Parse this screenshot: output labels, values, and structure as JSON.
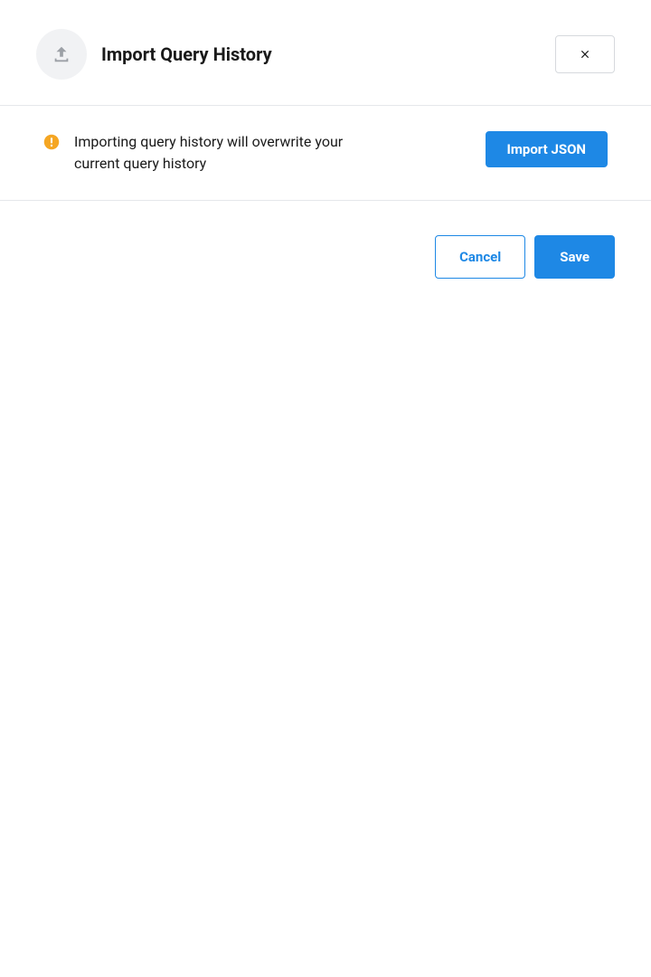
{
  "header": {
    "title": "Import Query History"
  },
  "warning": {
    "message": "Importing query history will overwrite your current query history"
  },
  "actions": {
    "import_label": "Import JSON",
    "cancel_label": "Cancel",
    "save_label": "Save"
  },
  "colors": {
    "primary": "#1e88e5",
    "warning": "#f5a623",
    "icon_muted": "#9ca0a6",
    "border": "#e5e7eb"
  }
}
